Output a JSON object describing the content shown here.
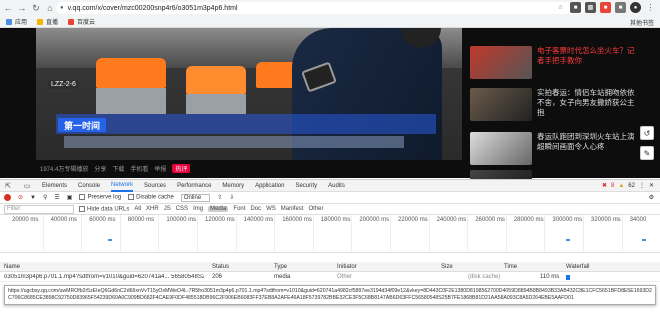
{
  "browser": {
    "url": "v.qq.com/x/cover/mzc00200snp4r6/o3051m3p4p6.html",
    "bookmarks": [
      {
        "label": "应用",
        "icon": "apps-icon"
      },
      {
        "label": "直播",
        "icon": "bookmark-icon"
      },
      {
        "label": "百度云",
        "icon": "bookmark-icon"
      }
    ],
    "other_bookmarks": "其他书签"
  },
  "video": {
    "caption_tag": "第一时间",
    "station_sign": "LZZ-2-6",
    "meta": [
      "1974.4万专辑播放",
      "分享",
      "下载",
      "手机看",
      "举报"
    ],
    "hot_badge": "热评"
  },
  "news": [
    {
      "title": "电子客票时代怎么坐火车？记者手把手教你",
      "color": "#ff3b3b"
    },
    {
      "title": "实拍春运：情侣车站拥吻依依不舍，女子向男友撒娇获公主抱",
      "color": "#dddddd"
    },
    {
      "title": "春运队跑团到深圳火车站上演超瞬间画面令人心疼",
      "color": "#dddddd"
    },
    {
      "title": "",
      "color": "#dddddd"
    }
  ],
  "devtools": {
    "tabs": [
      "Elements",
      "Console",
      "Network",
      "Sources",
      "Performance",
      "Memory",
      "Application",
      "Security",
      "Audits"
    ],
    "active_tab": "Network",
    "errors": "8",
    "warnings": "62",
    "toolbar": {
      "preserve_log": "Preserve log",
      "disable_cache": "Disable cache",
      "throttle": "Online"
    },
    "filter": {
      "placeholder": "Filter",
      "hide_data_urls": "Hide data URLs",
      "types": [
        "All",
        "XHR",
        "JS",
        "CSS",
        "Img",
        "Media",
        "Font",
        "Doc",
        "WS",
        "Manifest",
        "Other"
      ],
      "active_type": "Media"
    },
    "timeline_ticks": [
      "20000 ms",
      "40000 ms",
      "60000 ms",
      "80000 ms",
      "100000 ms",
      "120000 ms",
      "140000 ms",
      "160000 ms",
      "180000 ms",
      "200000 ms",
      "220000 ms",
      "240000 ms",
      "260000 ms",
      "280000 ms",
      "300000 ms",
      "320000 ms",
      "34000"
    ],
    "columns": [
      "Name",
      "Status",
      "Type",
      "Initiator",
      "Size",
      "Time",
      "Waterfall"
    ],
    "rows": [
      {
        "name": "o3051m3p4p6.p701.1.mp4?sdtfrom=v1010&guid=620741a4... 56580548S25...",
        "status": "206",
        "type": "media",
        "initiator": "Other",
        "size": "(disk cache)",
        "time": "110 ms"
      }
    ],
    "tooltip": "https://ugcbsy.qq.com/uwMROfb2r5zEIeQ6Gd6nC2d66xnVvT15yOxMWeO4L-7R5fro3051m3p4p6.p701.1.mp4?sdtfrom=v1010&guid=620741a4982cf5897ee3194d34f09e12&vkey=8D443C0F2E1380D8198562700D4059D8894B8B8493B33AB432C8E1CFC5651BFD8E5E1693D2C706C8685CE3898C92750D83965F54239D60A0C909BD682F4CAE9F0DF485518DB96C2F906EB6083FF37EB8A2AFE46A18F5739782BBE32CE3F5C68B8147AB6D63FFC56580548S25B7FE1868B81D21AA58A093C8A5D264EBE5AAFD01"
  }
}
